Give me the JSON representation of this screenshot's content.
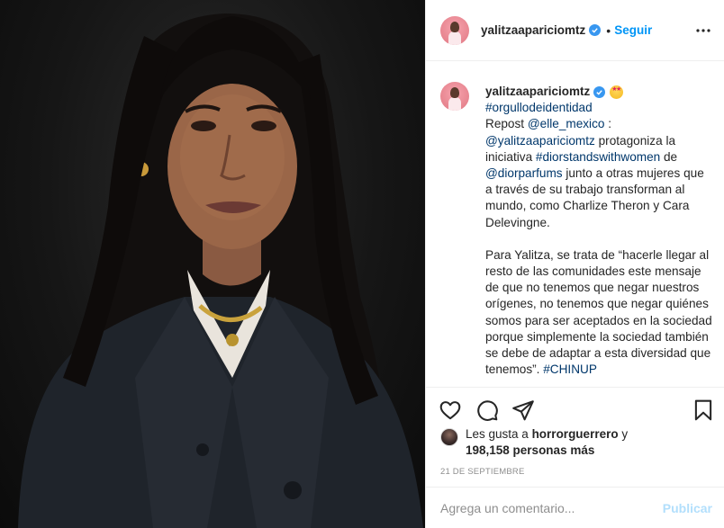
{
  "post": {
    "username": "yalitzaapariciomtz",
    "separator": "•",
    "follow_label": "Seguir",
    "more_icon": "more-horizontal-icon",
    "verified_icon": "verified-badge-icon"
  },
  "caption": {
    "username": "yalitzaapariciomtz",
    "emoji": "star-struck-emoji",
    "hashtag1": "#orgullodeidentidad",
    "repost_prefix": "Repost ",
    "repost_handle": "@elle_mexico",
    "repost_colon": " :",
    "mention1": "@yalitzaapariciomtz",
    "text1": " protagoniza la iniciativa ",
    "hashtag2": "#diorstandswithwomen",
    "text2": " de ",
    "mention2": "@diorparfums",
    "text3": " junto a otras mujeres que a través de su trabajo transforman al mundo, como Charlize Theron y Cara Delevingne.",
    "paragraph2": "Para Yalitza, se trata de “hacerle llegar al resto de las comunidades este mensaje de que no tenemos que negar nuestros orígenes, no tenemos que negar quiénes somos para ser aceptados en la sociedad porque simplemente la sociedad también se debe de adaptar a esta diversidad que tenemos”. ",
    "hashtag3": "#CHINUP"
  },
  "actions": {
    "like_icon": "heart-icon",
    "comment_icon": "comment-icon",
    "share_icon": "share-icon",
    "save_icon": "bookmark-icon"
  },
  "likes": {
    "prefix": "Les gusta a ",
    "user": "horrorguerrero",
    "connector": " y",
    "count": "198,158 personas más"
  },
  "date": "21 DE SEPTIEMBRE",
  "comment": {
    "placeholder": "Agrega un comentario...",
    "publish_label": "Publicar"
  },
  "colors": {
    "accent": "#0095f6",
    "link": "#00376b",
    "muted": "#8e8e8e",
    "publish_disabled": "#b2dffc",
    "verified": "#3897f0"
  }
}
